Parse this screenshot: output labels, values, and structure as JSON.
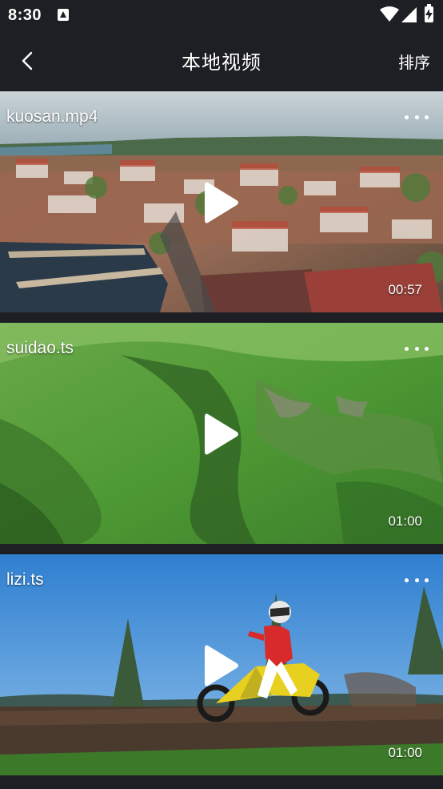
{
  "status_bar": {
    "time": "8:30"
  },
  "header": {
    "title": "本地视频",
    "sort_label": "排序"
  },
  "videos": [
    {
      "name": "kuosan.mp4",
      "duration": "00:57"
    },
    {
      "name": "suidao.ts",
      "duration": "01:00"
    },
    {
      "name": "lizi.ts",
      "duration": "01:00"
    }
  ],
  "colors": {
    "background": "#1d1f24",
    "text": "#ffffff"
  },
  "icons": {
    "back": "chevron-left-icon",
    "more": "more-dots-icon",
    "play": "play-icon",
    "wifi": "wifi-icon",
    "signal": "signal-icon",
    "battery": "battery-charging-icon",
    "notification": "notification-a-icon"
  }
}
